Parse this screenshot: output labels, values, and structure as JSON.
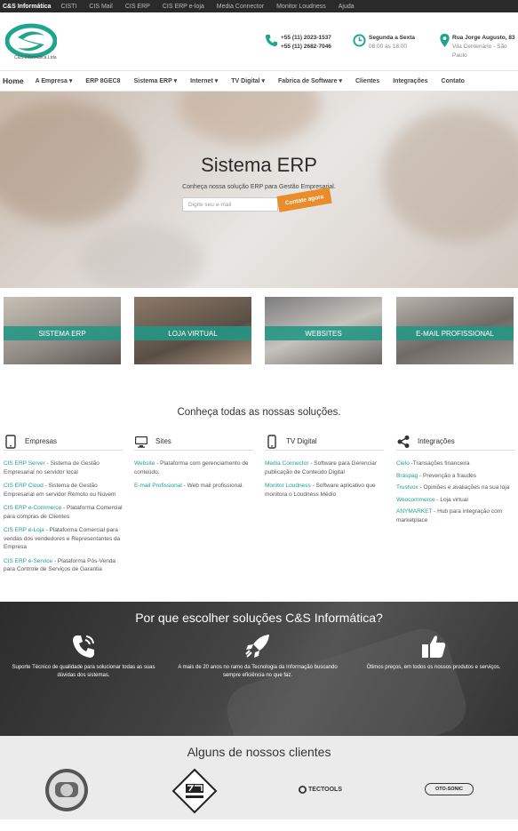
{
  "topbar": {
    "brand": "C&S Informática",
    "links": [
      "CISTI",
      "CIS Mail",
      "CIS ERP",
      "CIS ERP e-loja",
      "Media Connector",
      "Monitor Loudness",
      "Ajuda"
    ]
  },
  "header": {
    "logo_text": "C&S Informática Ltda",
    "phone1": "+55 (11) 2023-1537",
    "phone2": "+55 (11) 2682-7046",
    "hours_title": "Segunda a Sexta",
    "hours": "08:00 às 18:00",
    "address_bold": "Rua Jorge Augusto, 83",
    "address_rest": "Vila Centenário - São Paulo"
  },
  "nav": {
    "home": "Home",
    "items": [
      "A Empresa ▾",
      "ERP 8GEC8",
      "Sistema ERP ▾",
      "Internet ▾",
      "TV Digital ▾",
      "Fabrica de Software ▾",
      "Clientes",
      "Integrações",
      "Contato"
    ]
  },
  "hero": {
    "title": "Sistema ERP",
    "subtitle": "Conheça nossa solução ERP para Gestão Empresarial.",
    "placeholder": "Digite seu e-mail",
    "button": "Contate agora"
  },
  "cards": [
    "SISTEMA ERP",
    "LOJA VIRTUAL",
    "WEBSITES",
    "E-MAIL PROFISSIONAL"
  ],
  "solutions": {
    "title": "Conheça todas as nossas soluções.",
    "columns": [
      {
        "title": "Empresas",
        "icon": "tablet-icon",
        "items": [
          {
            "link": "CIS ERP Server",
            "text": " - Sistema de Gestão Empresarial no servidor local"
          },
          {
            "link": "CIS ERP Cloud",
            "text": " - Sistema de Gestão Empresarial em servidor Remoto ou Nuvem"
          },
          {
            "link": "CIS ERP e-Commerce",
            "text": " - Plataforma Comercial para compras de Clientes"
          },
          {
            "link": "CIS ERP e-Loja",
            "text": " - Plataforma Comercial para vendas dos vendedores e Representantes da Empresa"
          },
          {
            "link": "CIS ERP e-Service",
            "text": " - Plataforma Pós-Venda para Controle de Serviços de Garantia"
          }
        ]
      },
      {
        "title": "Sites",
        "icon": "monitor-icon",
        "items": [
          {
            "link": "Website",
            "text": " - Plataforma com gerenciamento de conteúdo."
          },
          {
            "link": "E-mail Profissional",
            "text": " - Web mail profissional."
          }
        ]
      },
      {
        "title": "TV Digital",
        "icon": "phone-icon",
        "items": [
          {
            "link": "Media Connector",
            "text": " - Software para Gerenciar publicação de Conteúdo Digital"
          },
          {
            "link": "Monitor Loudness",
            "text": " - Software aplicativo que monitora o Loudness Médio"
          }
        ]
      },
      {
        "title": "Integrações",
        "icon": "share-icon",
        "items": [
          {
            "link": "Cielo",
            "text": " -Transações financeira"
          },
          {
            "link": "Braspag",
            "text": " - Prevenção a fraudes"
          },
          {
            "link": "Trustvox",
            "text": " - Opiniões e avaliações na sua loja"
          },
          {
            "link": "Woocommerce",
            "text": " - Loja virtual"
          },
          {
            "link": "ANYMARKET",
            "text": " - Hub para integração com marketplace"
          }
        ]
      }
    ]
  },
  "why": {
    "title": "Por que escolher soluções C&S Informática?",
    "items": [
      {
        "icon": "support-phone-icon",
        "text": "Suporte Técnico de qualidade para solucionar todas as suas dúvidas dos sistemas."
      },
      {
        "icon": "rocket-icon",
        "text": "A mais de 20 anos no ramo da Tecnologia da Informação buscando sempre eficiência no que faz."
      },
      {
        "icon": "thumbs-up-icon",
        "text": "Ótimos preços, em todos os nossos produtos e serviços."
      }
    ]
  },
  "clients": {
    "title": "Alguns de nossos clientes",
    "logos": [
      "TECTOOLS",
      "OTO-SONIC"
    ]
  },
  "colors": {
    "accent": "#20a08a",
    "button": "#e98c2b",
    "topbar": "#2a2a2a"
  }
}
